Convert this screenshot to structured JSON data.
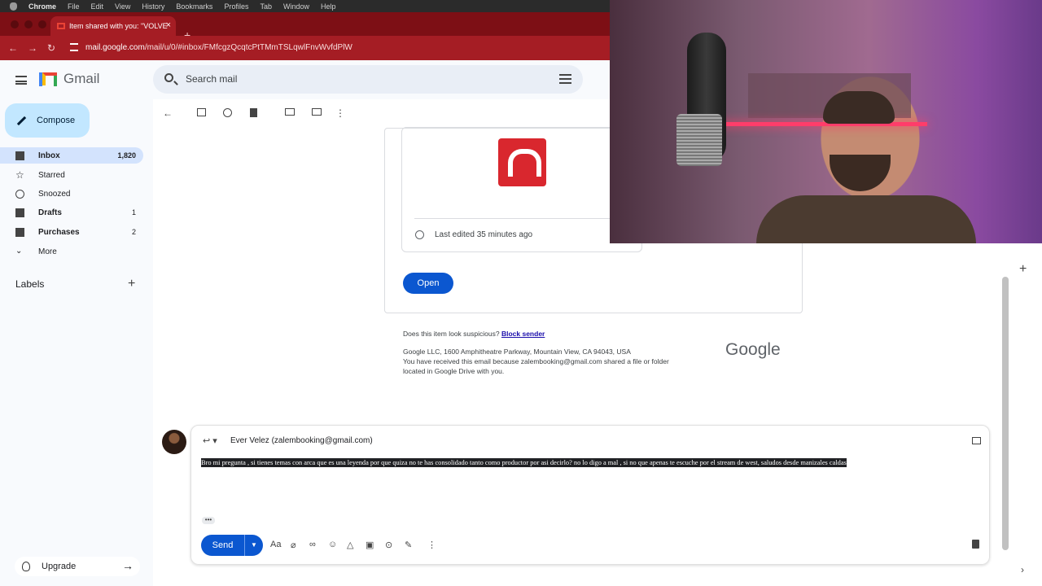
{
  "menubar": {
    "app": "Chrome",
    "items": [
      "File",
      "Edit",
      "View",
      "History",
      "Bookmarks",
      "Profiles",
      "Tab",
      "Window",
      "Help"
    ]
  },
  "browser": {
    "tab_title": "Item shared with you: \"VOLVE",
    "new_tab": "+",
    "url_domain": "mail.google.com",
    "url_path": "/mail/u/0/#inbox/FMfcgzQcqtcPtTMmTSLqwlFnvWvfdPlW"
  },
  "header": {
    "product": "Gmail",
    "search_placeholder": "Search mail"
  },
  "sidebar": {
    "compose": "Compose",
    "items": [
      {
        "label": "Inbox",
        "count": "1,820"
      },
      {
        "label": "Starred",
        "count": ""
      },
      {
        "label": "Snoozed",
        "count": ""
      },
      {
        "label": "Drafts",
        "count": "1"
      },
      {
        "label": "Purchases",
        "count": "2"
      },
      {
        "label": "More",
        "count": ""
      }
    ],
    "labels_heading": "Labels",
    "upgrade": "Upgrade"
  },
  "email": {
    "last_edited": "Last edited 35 minutes ago",
    "open_button": "Open",
    "suspicious": "Does this item look suspicious?",
    "block_sender": "Block sender",
    "address": "Google LLC, 1600 Amphitheatre Parkway, Mountain View, CA 94043, USA",
    "reason_line1": "You have received this email because zalembooking@gmail.com shared a file or folder",
    "reason_line2": "located in Google Drive with you.",
    "google_logo": "Google"
  },
  "reply": {
    "recipient": "Ever Velez (zalembooking@gmail.com)",
    "body": "Bro mi pregunta , si tienes temas con arca que es una leyenda por que quiza no te has consolidado tanto como productor por asi decirlo? no lo digo a mal , si no que apenas te escuche por el stream de west, saludos desde manizales caldas",
    "send": "Send",
    "format_label": "Aa"
  },
  "colors": {
    "chrome_bar": "#a51d24",
    "compose_bg": "#c2e7ff",
    "active_item": "#d3e3fd",
    "primary_button": "#0b57d0"
  }
}
